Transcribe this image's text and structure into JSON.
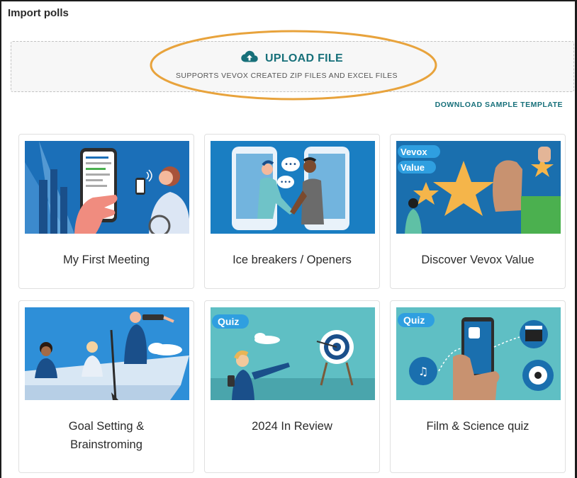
{
  "header": {
    "title": "Import polls"
  },
  "upload": {
    "label": "UPLOAD FILE",
    "subtitle": "SUPPORTS VEVOX CREATED ZIP FILES AND EXCEL FILES",
    "icon": "cloud-upload-icon",
    "accent_color": "#17707a",
    "highlight_color": "#e8a33c"
  },
  "download_link": {
    "label": "DOWNLOAD SAMPLE TEMPLATE"
  },
  "templates": [
    {
      "title": "My First Meeting"
    },
    {
      "title": "Ice breakers / Openers"
    },
    {
      "title": "Discover Vevox Value",
      "badge_lines": [
        "Vevox",
        "Value"
      ]
    },
    {
      "title_lines": [
        "Goal Setting &",
        "Brainstroming"
      ]
    },
    {
      "title": "2024 In Review",
      "badge": "Quiz"
    },
    {
      "title": "Film & Science quiz",
      "badge": "Quiz"
    }
  ]
}
